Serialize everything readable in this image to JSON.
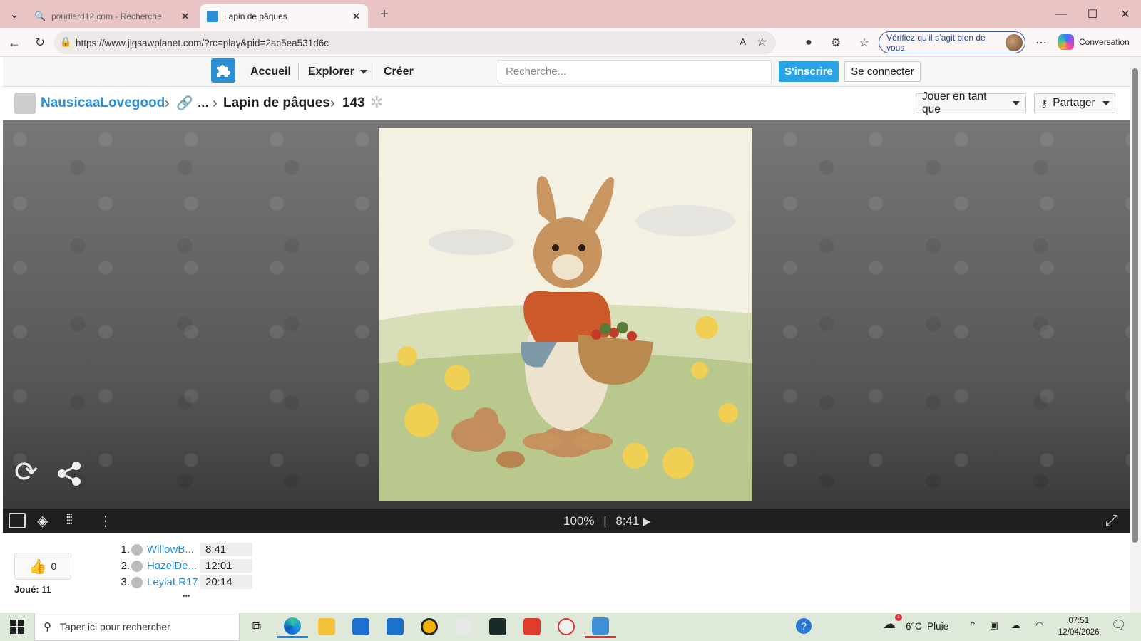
{
  "browser": {
    "tabs": [
      {
        "label": "poudlard12.com - Recherche"
      },
      {
        "label": "Lapin de pâques"
      }
    ],
    "url": "https://www.jigsawplanet.com/?rc=play&pid=2ac5ea531d6c",
    "verify_label": "Vérifiez qu’il s’agit bien de vous",
    "copilot_label": "Conversation"
  },
  "site": {
    "nav": {
      "home": "Accueil",
      "explore": "Explorer",
      "create": "Créer"
    },
    "search_placeholder": "Recherche...",
    "signup": "S'inscrire",
    "login": "Se connecter"
  },
  "breadcrumb": {
    "user": "NausicaaLovegood",
    "ellipsis": "...",
    "title": "Lapin de pâques",
    "pieces": "143"
  },
  "actions": {
    "play_as": "Jouer en tant que",
    "share": "Partager"
  },
  "controls": {
    "zoom": "100%",
    "separator": "|",
    "timer": "8:41"
  },
  "stats": {
    "likes": "0",
    "played_label": "Joué:",
    "played_count": "11"
  },
  "leaderboard": [
    {
      "rank": "1.",
      "name": "WillowB...",
      "time": "8:41"
    },
    {
      "rank": "2.",
      "name": "HazelDe...",
      "time": "12:01"
    },
    {
      "rank": "3.",
      "name": "LeylaLR17",
      "time": "20:14"
    }
  ],
  "leaderboard_more": "•••",
  "taskbar": {
    "search_placeholder": "Taper ici pour rechercher",
    "weather": "6°C  Pluie",
    "time": "07:51",
    "date": "12/04/2026",
    "notif_count": "1"
  }
}
